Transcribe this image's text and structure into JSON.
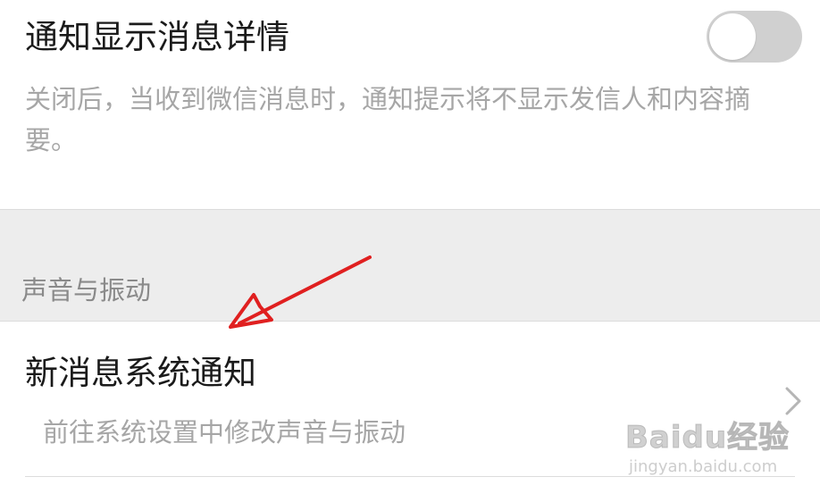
{
  "detail_setting": {
    "title": "通知显示消息详情",
    "description": "关闭后，当收到微信消息时，通知提示将不显示发信人和内容摘要。",
    "toggle_state": "off"
  },
  "section": {
    "label": "声音与振动"
  },
  "system_notification": {
    "title": "新消息系统通知",
    "description": "前往系统设置中修改声音与振动"
  },
  "icons": {
    "chevron": "chevron-right-icon",
    "annotation": "red-arrow-icon"
  },
  "colors": {
    "annotation_arrow": "#e02020",
    "toggle_off": "#d0d0d0",
    "section_background": "#ededed"
  },
  "watermark": {
    "brand": "Baidu经验",
    "url": "jingyan.baidu.com"
  }
}
